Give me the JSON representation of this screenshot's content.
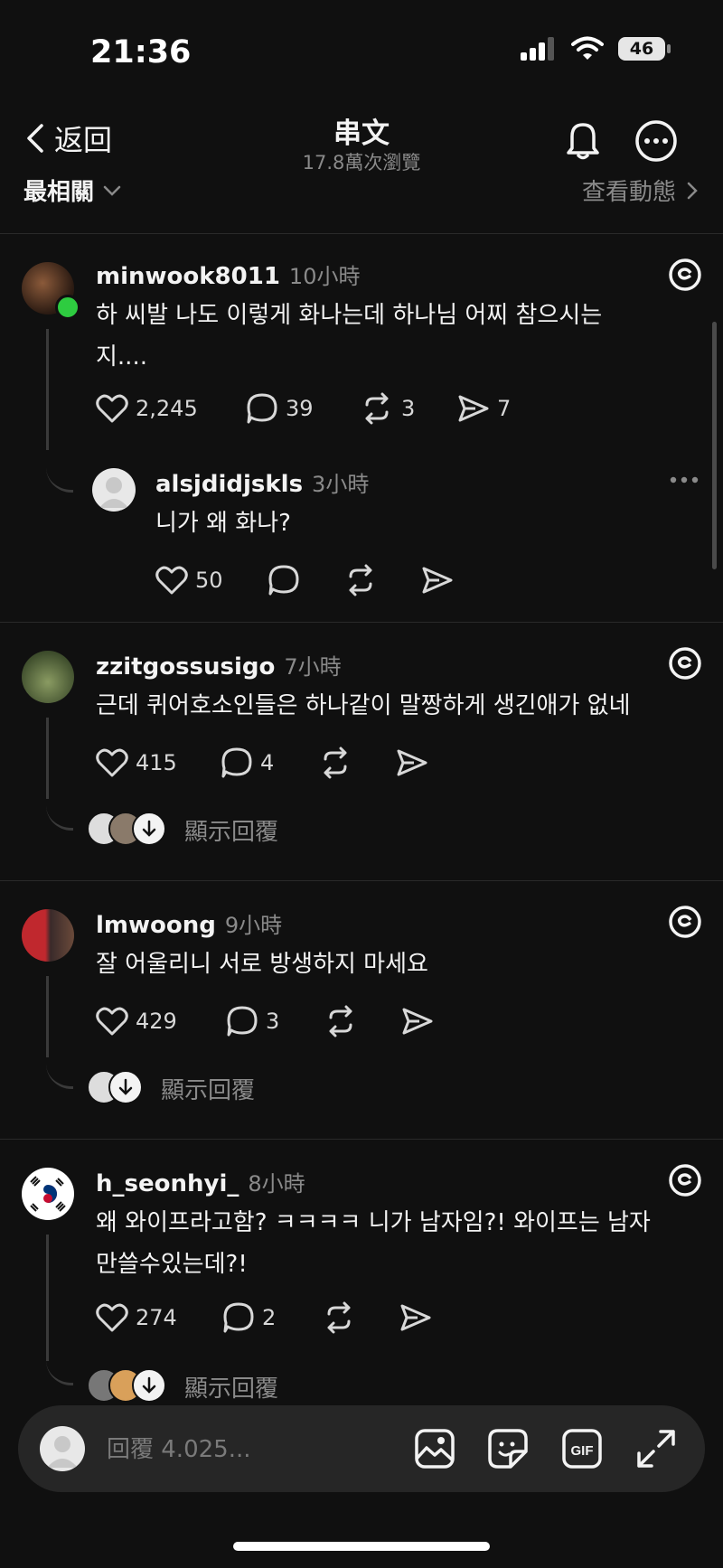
{
  "status": {
    "time": "21:36",
    "battery": "46"
  },
  "header": {
    "back_label": "返回",
    "title": "串文",
    "subtitle": "17.8萬次瀏覽"
  },
  "sortbar": {
    "sort_label": "最相關",
    "activity_label": "查看動態"
  },
  "posts": [
    {
      "username": "minwook8011",
      "time": "10小時",
      "text_line1": "하 씨발 나도 이렇게 화나는데 하나님 어찌 참으시는",
      "text_line2": "지....",
      "likes": "2,245",
      "replies": "39",
      "reposts": "3",
      "shares": "7",
      "reply": {
        "username": "alsjdidjskls",
        "time": "3小時",
        "text": "니가 왜 화나?",
        "likes": "50"
      }
    },
    {
      "username": "zzitgossusigo",
      "time": "7小時",
      "text_line1": "근데 퀴어호소인들은 하나같이 말짱하게 생긴애가 없네",
      "likes": "415",
      "replies": "4",
      "show_replies": "顯示回覆"
    },
    {
      "username": "lmwoong",
      "time": "9小時",
      "text_line1": "잘 어울리니 서로 방생하지 마세요",
      "likes": "429",
      "replies": "3",
      "show_replies": "顯示回覆"
    },
    {
      "username": "h_seonhyi_",
      "time": "8小時",
      "text_line1": "왜 와이프라고함? ㅋㅋㅋㅋ 니가 남자임?! 와이프는 남자",
      "text_line2": "만쓸수있는데?!",
      "likes": "274",
      "replies": "2",
      "show_replies": "顯示回覆"
    }
  ],
  "reply_bar": {
    "placeholder": "回覆 4.025..."
  },
  "icons": {
    "back": "chevron-left-icon",
    "bell": "bell-icon",
    "more": "more-icon",
    "like": "heart-icon",
    "comment": "comment-icon",
    "repost": "repost-icon",
    "share": "send-icon",
    "threads": "threads-logo-icon",
    "image": "image-icon",
    "sticker": "sticker-icon",
    "gif": "gif-icon",
    "expand": "expand-icon"
  }
}
